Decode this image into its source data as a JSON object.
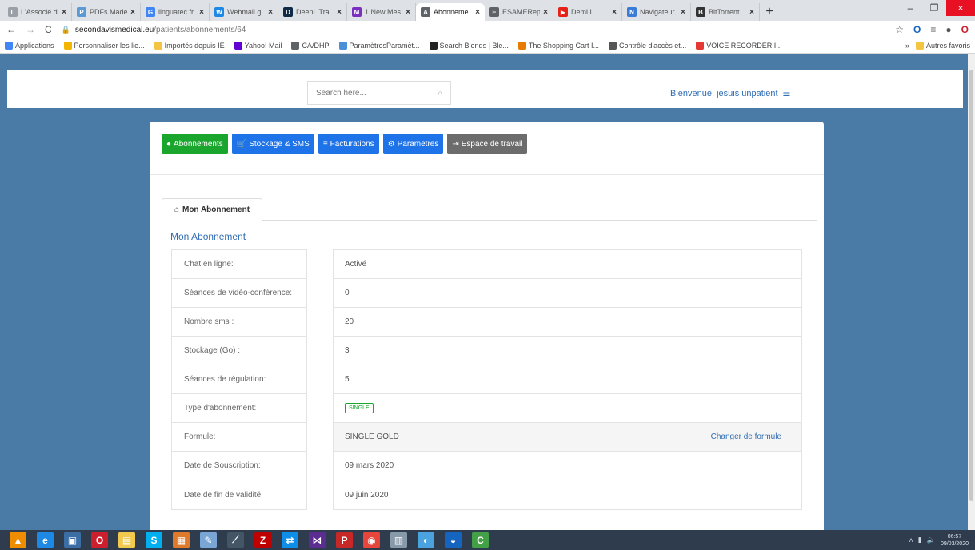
{
  "browser": {
    "tabs": [
      {
        "title": "L'Associé d...",
        "color": "#9aa0a6",
        "letter": "L",
        "active": false
      },
      {
        "title": "PDFs Made...",
        "color": "#5b9bd5",
        "letter": "P",
        "active": false
      },
      {
        "title": "linguatec fr",
        "color": "#4285f4",
        "letter": "G",
        "active": false
      },
      {
        "title": "Webmail g...",
        "color": "#1e88e5",
        "letter": "W",
        "active": false
      },
      {
        "title": "DeepL Tra...",
        "color": "#0f2b46",
        "letter": "D",
        "active": false
      },
      {
        "title": "1 New Mes...",
        "color": "#7b2fbf",
        "letter": "M",
        "active": false
      },
      {
        "title": "Abonneme...",
        "color": "#5f6368",
        "letter": "A",
        "active": true
      },
      {
        "title": "ESAMERep...",
        "color": "#5f6368",
        "letter": "E",
        "active": false
      },
      {
        "title": "Demi L...",
        "color": "#e62117",
        "letter": "▶",
        "active": false
      },
      {
        "title": "Navigateur...",
        "color": "#3a7bd5",
        "letter": "N",
        "active": false
      },
      {
        "title": "BitTorrent...",
        "color": "#333333",
        "letter": "B",
        "active": false
      }
    ],
    "url_host": "secondavismedical.eu",
    "url_path": "/patients/abonnements/64",
    "bookmarks": [
      {
        "label": "Applications",
        "color": "#4285f4"
      },
      {
        "label": "Personnaliser les lie...",
        "color": "#f4b400"
      },
      {
        "label": "Importés depuis IE",
        "color": "#f4c542"
      },
      {
        "label": "Yahoo! Mail",
        "color": "#6001d2"
      },
      {
        "label": "CA/DHP",
        "color": "#5f6368"
      },
      {
        "label": "ParamètresParamèt...",
        "color": "#4a90d9"
      },
      {
        "label": "Search Blends | Ble...",
        "color": "#222222"
      },
      {
        "label": "The Shopping Cart I...",
        "color": "#e57c00"
      },
      {
        "label": "Contrôle d'accès et...",
        "color": "#555555"
      },
      {
        "label": "VOICE RECORDER I...",
        "color": "#e53935"
      }
    ],
    "bookmarks_other": "Autres favoris"
  },
  "header": {
    "search_placeholder": "Search here...",
    "welcome": "Bienvenue, jesuis unpatient"
  },
  "nav_buttons": [
    {
      "label": "Abonnements",
      "icon": "●",
      "color": "#1aa52d"
    },
    {
      "label": "Stockage & SMS",
      "icon": "🛒",
      "color": "#1e73e8"
    },
    {
      "label": "Facturations",
      "icon": "≡",
      "color": "#1e73e8"
    },
    {
      "label": "Parametres",
      "icon": "⚙",
      "color": "#1e73e8"
    },
    {
      "label": "Espace de travail",
      "icon": "⇥",
      "color": "#6c6c6c"
    }
  ],
  "tab_label": "Mon Abonnement",
  "section_title": "Mon Abonnement",
  "details": [
    {
      "label": "Chat en ligne:",
      "value": "Activé"
    },
    {
      "label": "Séances de vidéo-conférence:",
      "value": "0"
    },
    {
      "label": "Nombre sms :",
      "value": "20"
    },
    {
      "label": "Stockage (Go) :",
      "value": "3"
    },
    {
      "label": "Séances de régulation:",
      "value": "5"
    },
    {
      "label": "Type d'abonnement:",
      "value": "SINGLE",
      "badge": true
    },
    {
      "label": "Formule:",
      "value": "SINGLE GOLD",
      "action": "Changer de formule"
    },
    {
      "label": "Date de Souscription:",
      "value": "09 mars 2020"
    },
    {
      "label": "Date de fin de validité:",
      "value": "09 juin 2020"
    }
  ],
  "taskbar": {
    "apps": [
      {
        "name": "vlc-icon",
        "color": "#f08c00",
        "glyph": "▲"
      },
      {
        "name": "internet-explorer-icon",
        "color": "#1e88e5",
        "glyph": "e"
      },
      {
        "name": "app-icon",
        "color": "#3b6ea5",
        "glyph": "▣"
      },
      {
        "name": "opera-icon",
        "color": "#cc1f2d",
        "glyph": "O"
      },
      {
        "name": "folder-icon",
        "color": "#f2c94c",
        "glyph": "▤"
      },
      {
        "name": "skype-icon",
        "color": "#00aff0",
        "glyph": "S"
      },
      {
        "name": "files-icon",
        "color": "#e07a2b",
        "glyph": "▦"
      },
      {
        "name": "paint-icon",
        "color": "#7aa6d6",
        "glyph": "✎"
      },
      {
        "name": "tool-icon",
        "color": "#445566",
        "glyph": "⟋"
      },
      {
        "name": "filezilla-icon",
        "color": "#bf0000",
        "glyph": "Z"
      },
      {
        "name": "teamviewer-icon",
        "color": "#0e8ee9",
        "glyph": "⇄"
      },
      {
        "name": "visual-studio-icon",
        "color": "#5c2d91",
        "glyph": "⋈"
      },
      {
        "name": "pdf-icon",
        "color": "#c62828",
        "glyph": "P"
      },
      {
        "name": "chrome-icon",
        "color": "#e8453c",
        "glyph": "◉"
      },
      {
        "name": "calculator-icon",
        "color": "#8899aa",
        "glyph": "▥"
      },
      {
        "name": "browser-icon",
        "color": "#4aa3df",
        "glyph": "◐"
      },
      {
        "name": "app-blue-icon",
        "color": "#1565c0",
        "glyph": "◒"
      },
      {
        "name": "camtasia-icon",
        "color": "#43a047",
        "glyph": "C"
      }
    ],
    "time": "06:57",
    "date": "09/03/2020"
  }
}
